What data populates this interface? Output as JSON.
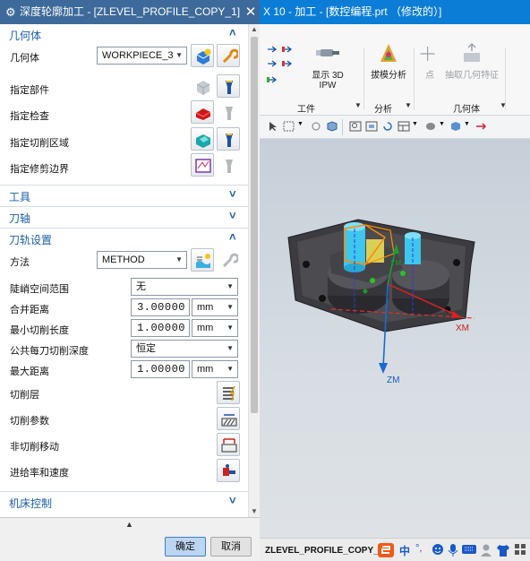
{
  "app": {
    "title": "X 10 - 加工 - [数控编程.prt （修改的）]",
    "ribbon": {
      "show_ipw_label": "显示 3D IPW",
      "sweep_analysis_label": "拔模分析",
      "point_label": "点",
      "extract_geometry_label": "抽取几何特征",
      "group_work": "工件",
      "group_analysis": "分析",
      "group_geometry": "几何体"
    },
    "viewport": {
      "axis_xm": "XM",
      "axis_ym": "YM",
      "axis_zm": "ZM"
    },
    "status_text": "ZLEVEL_PROFILE_COPY_1",
    "ime_label": "中"
  },
  "dialog": {
    "title": "深度轮廓加工 - [ZLEVEL_PROFILE_COPY_1]",
    "close_glyph": "✕",
    "sections": {
      "geometry": {
        "title": "几何体",
        "geometry_label": "几何体",
        "geometry_value": "WORKPIECE_3",
        "part_label": "指定部件",
        "check_label": "指定检查",
        "cut_area_label": "指定切削区域",
        "trim_boundary_label": "指定修剪边界"
      },
      "tool": {
        "title": "工具"
      },
      "axis": {
        "title": "刀轴"
      },
      "path": {
        "title": "刀轨设置",
        "method_label": "方法",
        "method_value": "METHOD",
        "steep_label": "陡峭空间范围",
        "steep_value": "无",
        "merge_label": "合并距离",
        "merge_value": "3.00000",
        "merge_unit": "mm",
        "min_cut_label": "最小切削长度",
        "min_cut_value": "1.00000",
        "min_cut_unit": "mm",
        "depth_label": "公共每刀切削深度",
        "depth_value": "恒定",
        "max_dist_label": "最大距离",
        "max_dist_value": "1.00000",
        "max_dist_unit": "mm",
        "levels_label": "切削层",
        "params_label": "切削参数",
        "noncut_label": "非切削移动",
        "feeds_label": "进给率和速度"
      },
      "machine": {
        "title": "机床控制"
      }
    },
    "ok_label": "确定",
    "cancel_label": "取消"
  }
}
